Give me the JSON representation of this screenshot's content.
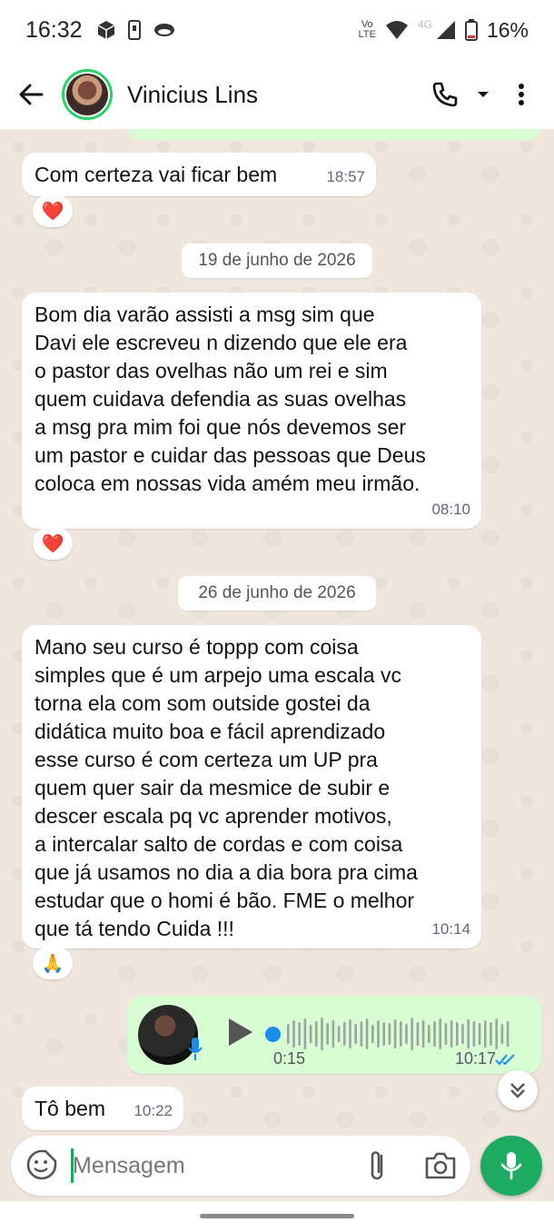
{
  "status_bar": {
    "time": "16:32",
    "volte_top": "Vo",
    "volte_bottom": "LTE",
    "network": "4G",
    "battery": "16%",
    "icons": [
      "box-icon",
      "sim-icon",
      "cloud-icon",
      "wifi-icon",
      "signal-icon",
      "battery-icon"
    ]
  },
  "header": {
    "contact_name": "Vinicius Lins",
    "icons": [
      "back-arrow-icon",
      "phone-icon",
      "chevron-down-icon",
      "more-vertical-icon"
    ]
  },
  "messages": [
    {
      "type": "text",
      "direction": "in",
      "text": "Com certeza vai ficar bem",
      "time": "18:57",
      "reaction": "❤️"
    },
    {
      "type": "date",
      "text": "19 de junho de 2026"
    },
    {
      "type": "text",
      "direction": "in",
      "text": "Bom dia varão assisti a msg sim que\nDavi ele escreveu n dizendo que ele era\no pastor das ovelhas não um rei e sim\nquem cuidava defendia as suas ovelhas\na msg pra mim foi que nós devemos ser\num pastor e cuidar das pessoas que Deus\ncoloca em nossas vida amém meu irmão.",
      "time": "08:10",
      "reaction": "❤️"
    },
    {
      "type": "date",
      "text": "26 de junho de 2026"
    },
    {
      "type": "text",
      "direction": "in",
      "text": "Mano seu curso é toppp com coisa\nsimples que é um arpejo uma escala vc\ntorna ela com som outside gostei da\ndidática muito boa e fácil aprendizado\nesse curso é com certeza um UP pra\nquem quer sair da mesmice de subir e\ndescer escala pq vc aprender motivos,\na intercalar salto de cordas e com coisa\nque já usamos no dia a dia bora pra cima\nestudar que o homi é bão. FME o melhor\nque tá tendo Cuida !!!",
      "time": "10:14",
      "reaction": "🙏"
    },
    {
      "type": "voice",
      "direction": "out",
      "duration": "0:15",
      "time": "10:17",
      "status": "read",
      "progress": 0
    },
    {
      "type": "text",
      "direction": "in",
      "text": "Tô bem",
      "time": "10:22"
    }
  ],
  "composer": {
    "placeholder": "Mensagem",
    "value": ""
  },
  "colors": {
    "accent": "#1daa61",
    "outgoing_bubble": "#d9fdd3",
    "incoming_bubble": "#ffffff",
    "chat_background": "#efe7de",
    "read_ticks": "#1a8cf0"
  }
}
